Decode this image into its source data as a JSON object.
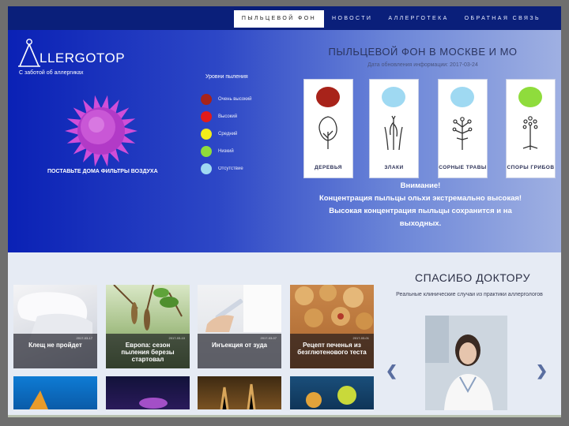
{
  "nav": {
    "items": [
      {
        "label": "ПЫЛЬЦЕВОЙ ФОН",
        "active": true
      },
      {
        "label": "НОВОСТИ",
        "active": false
      },
      {
        "label": "АЛЛЕРГОТЕКА",
        "active": false
      },
      {
        "label": "ОБРАТНАЯ СВЯЗЬ",
        "active": false
      }
    ]
  },
  "logo": {
    "text": "LLERGOTOP",
    "tagline": "С заботой об аллергиках"
  },
  "hero": {
    "filters_link": "ПОСТАВЬТЕ ДОМА ФИЛЬТРЫ ВОЗДУХА"
  },
  "legend": {
    "title": "Уровни пыления",
    "items": [
      {
        "label": "Очень высокий",
        "color": "#a8231a"
      },
      {
        "label": "Высокий",
        "color": "#e11b1b"
      },
      {
        "label": "Средний",
        "color": "#f2ec1a"
      },
      {
        "label": "Низкий",
        "color": "#8fdc3c"
      },
      {
        "label": "Отсутствие",
        "color": "#9fd9f2"
      }
    ]
  },
  "pollen_forecast": {
    "title": "ПЫЛЬЦЕВОЙ ФОН В МОСКВЕ И МО",
    "subtitle": "Дата обновления информации: 2017-03-24",
    "cards": [
      {
        "label": "ДЕРЕВЬЯ",
        "color": "#a8231a",
        "icon": "tree-icon"
      },
      {
        "label": "ЗЛАКИ",
        "color": "#9fd9f2",
        "icon": "grass-icon"
      },
      {
        "label": "СОРНЫЕ ТРАВЫ",
        "color": "#9fd9f2",
        "icon": "weed-icon"
      },
      {
        "label": "СПОРЫ ГРИБОВ",
        "color": "#8fdc3c",
        "icon": "fungus-icon"
      }
    ]
  },
  "alert": {
    "line1": "Внимание!",
    "line2": "Концентрация пыльцы ольхи экстремально высокая!",
    "line3": "Высокая концентрация пыльцы сохранится и на выходных."
  },
  "news": {
    "tiles": [
      {
        "title": "Клещ не пройдет",
        "date": "2017-03-17"
      },
      {
        "title": "Европа: сезон пыления березы стартовал",
        "date": "2017-03-10"
      },
      {
        "title": "Инъекция от зуда",
        "date": "2017-03-07"
      },
      {
        "title": "Рецепт печенья из безглютенового теста",
        "date": "2017-03-01"
      }
    ]
  },
  "thanks": {
    "title": "СПАСИБО ДОКТОРУ",
    "subtitle": "Реальные клинические случаи из практики аллергологов"
  }
}
